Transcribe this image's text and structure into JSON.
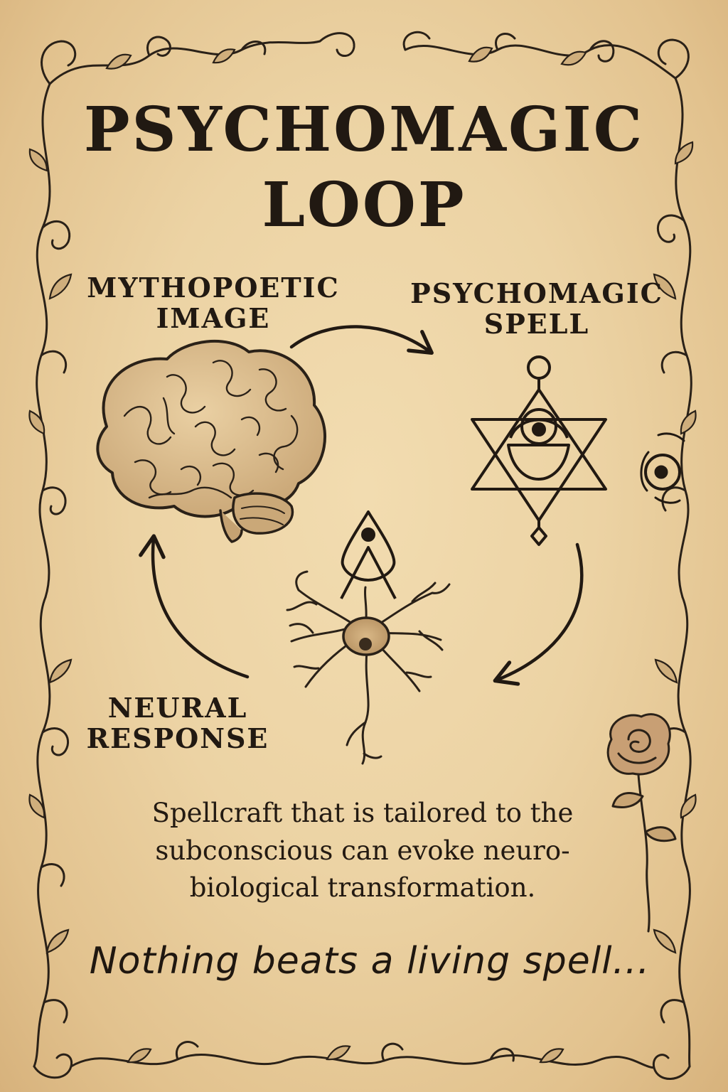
{
  "title": {
    "line1": "PSYCHOMAGIC",
    "line2": "LOOP"
  },
  "nodes": {
    "image": "MYTHOPOETIC IMAGE",
    "spell": "PSYCHOMAGIC SPELL",
    "neural": "NEURAL RESPONSE"
  },
  "caption": "Spellcraft that is tailored to the subconscious can evoke neuro-biological transformation.",
  "tagline": "Nothing beats a living spell...",
  "icons": {
    "image": "brain-icon",
    "spell": "hexagram-sigil-icon",
    "neural": "neuron-icon",
    "neural_sigil": "teardrop-sigil-icon",
    "eye": "eye-icon",
    "rose": "rose-icon",
    "border": "vine-border"
  },
  "colors": {
    "ink": "#211912",
    "parchment": "#ecd3a4"
  }
}
